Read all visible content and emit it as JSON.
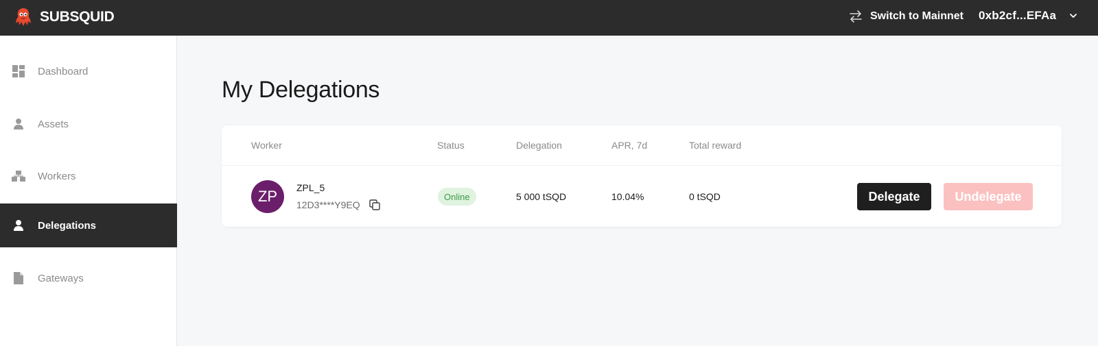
{
  "header": {
    "brand_name": "SUBSQUID",
    "switch_network_label": "Switch to Mainnet",
    "wallet_address": "0xb2cf...EFAa"
  },
  "sidebar": {
    "items": [
      {
        "label": "Dashboard",
        "icon": "dashboard-icon",
        "active": false
      },
      {
        "label": "Assets",
        "icon": "person-icon",
        "active": false
      },
      {
        "label": "Workers",
        "icon": "workers-icon",
        "active": false
      },
      {
        "label": "Delegations",
        "icon": "person-icon",
        "active": true
      },
      {
        "label": "Gateways",
        "icon": "document-icon",
        "active": false
      }
    ]
  },
  "main": {
    "title": "My Delegations",
    "table": {
      "headers": [
        "Worker",
        "Status",
        "Delegation",
        "APR, 7d",
        "Total reward"
      ],
      "rows": [
        {
          "avatar_initials": "ZP",
          "worker_name": "ZPL_5",
          "worker_id": "12D3****Y9EQ",
          "status": "Online",
          "delegation": "5 000 tSQD",
          "apr": "10.04%",
          "total_reward": "0 tSQD",
          "delegate_label": "Delegate",
          "undelegate_label": "Undelegate"
        }
      ]
    }
  },
  "colors": {
    "topbar": "#2c2c2c",
    "brand_accent": "#e8492f",
    "avatar": "#6b1f6a",
    "status_online_bg": "#dff3df",
    "status_online_text": "#3d9a45",
    "undelegate_disabled": "#fbc1c1"
  }
}
